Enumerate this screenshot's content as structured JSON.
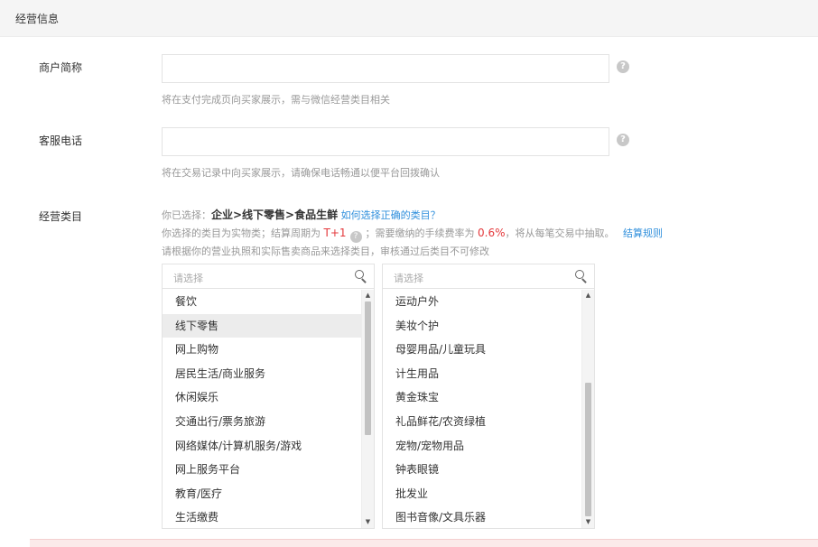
{
  "section": {
    "title": "经营信息"
  },
  "merchant_name": {
    "label": "商户简称",
    "value": "",
    "help_icon": "question-circle-icon",
    "hint": "将在支付完成页向买家展示，需与微信经营类目相关"
  },
  "service_phone": {
    "label": "客服电话",
    "value": "",
    "help_icon": "question-circle-icon",
    "hint": "将在交易记录中向买家展示，请确保电话畅通以便平台回拨确认"
  },
  "category": {
    "label": "经营类目",
    "selected_prefix": "你已选择：",
    "selected_path": "企业>线下零售>食品生鲜",
    "how_to_link": "如何选择正确的类目？",
    "fee_text_1": "你选择的类目为实物类；结算周期为",
    "settle_cycle": "T+1",
    "fee_text_2": "；需要缴纳的手续费率为",
    "fee_rate": "0.6%",
    "fee_text_3": "，将从每笔交易中抽取。",
    "settle_rule_link": "结算规则",
    "notice": "请根据你的营业执照和实际售卖商品来选择类目，审核通过后类目不可修改",
    "left_list": {
      "placeholder": "请选择",
      "items": [
        "餐饮",
        "线下零售",
        "网上购物",
        "居民生活/商业服务",
        "休闲娱乐",
        "交通出行/票务旅游",
        "网络媒体/计算机服务/游戏",
        "网上服务平台",
        "教育/医疗",
        "生活缴费"
      ],
      "selected": "线下零售",
      "scroll_fraction": 0.0
    },
    "right_list": {
      "placeholder": "请选择",
      "items": [
        "运动户外",
        "美妆个护",
        "母婴用品/儿童玩具",
        "计生用品",
        "黄金珠宝",
        "礼品鲜花/农资绿植",
        "宠物/宠物用品",
        "钟表眼镜",
        "批发业",
        "图书音像/文具乐器"
      ],
      "scroll_fraction": 1.0
    }
  },
  "colors": {
    "link": "#2f8fdc",
    "highlight": "#e4393c",
    "selected_bg": "#ececec"
  }
}
